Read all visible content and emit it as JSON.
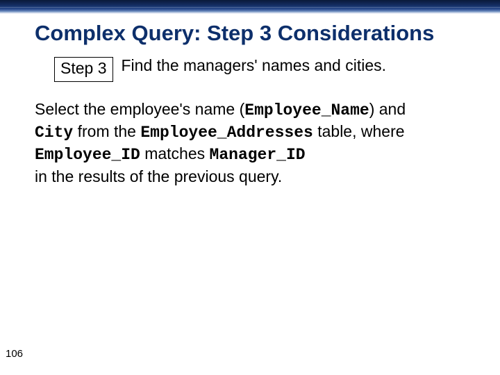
{
  "title": "Complex Query: Step 3 Considerations",
  "step": {
    "label": "Step 3",
    "desc": "Find the managers' names and cities."
  },
  "body": {
    "t1": "Select the employee's name (",
    "c1": "Employee_Name",
    "t2": ") and ",
    "c2": "City",
    "t3": " from the ",
    "c3": "Employee_Addresses",
    "t4": " table, where ",
    "c4": "Employee_ID",
    "t5": " matches ",
    "c5": "Manager_ID",
    "t6": "in the results of the previous query."
  },
  "page_number": "106"
}
